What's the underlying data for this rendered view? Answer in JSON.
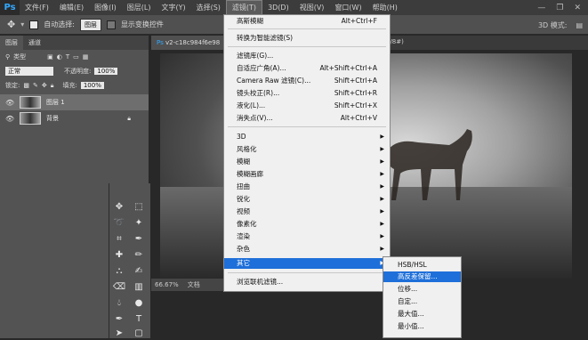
{
  "menubar": {
    "logo": "Ps",
    "items": [
      "文件(F)",
      "编辑(E)",
      "图像(I)",
      "图层(L)",
      "文字(Y)",
      "选择(S)",
      "滤镜(T)",
      "3D(D)",
      "视图(V)",
      "窗口(W)",
      "帮助(H)"
    ],
    "active_index": 6,
    "controls": [
      "—",
      "❐",
      "✕"
    ]
  },
  "options": {
    "auto_select_label": "自动选择:",
    "auto_select_value": "图层",
    "show_transform_label": "显示变换控件",
    "mode_3d": "3D 模式:"
  },
  "layers_panel": {
    "tabs": [
      "图层",
      "通道"
    ],
    "kind_label": "类型",
    "blend_mode": "正常",
    "opacity_label": "不透明度:",
    "opacity_value": "100%",
    "lock_label": "锁定:",
    "fill_label": "填充:",
    "fill_value": "100%",
    "layers": [
      {
        "name": "图层 1",
        "selected": true
      },
      {
        "name": "背景",
        "selected": false
      }
    ]
  },
  "document": {
    "tab_title": "v2-c18c984f6e98",
    "tab_suffix": "8/8#)",
    "zoom": "66.67%",
    "doc_label": "文档"
  },
  "filter_menu": {
    "items": [
      {
        "label": "高斯模糊",
        "shortcut": "Alt+Ctrl+F"
      },
      {
        "label": "转换为智能滤镜(S)",
        "shortcut": ""
      },
      {
        "label": "滤镜库(G)...",
        "shortcut": ""
      },
      {
        "label": "自适应广角(A)...",
        "shortcut": "Alt+Shift+Ctrl+A"
      },
      {
        "label": "Camera Raw 滤镜(C)...",
        "shortcut": "Shift+Ctrl+A"
      },
      {
        "label": "镜头校正(R)...",
        "shortcut": "Shift+Ctrl+R"
      },
      {
        "label": "液化(L)...",
        "shortcut": "Shift+Ctrl+X"
      },
      {
        "label": "消失点(V)...",
        "shortcut": "Alt+Ctrl+V"
      },
      {
        "label": "3D",
        "submenu": true
      },
      {
        "label": "风格化",
        "submenu": true
      },
      {
        "label": "模糊",
        "submenu": true
      },
      {
        "label": "模糊画廊",
        "submenu": true
      },
      {
        "label": "扭曲",
        "submenu": true
      },
      {
        "label": "锐化",
        "submenu": true
      },
      {
        "label": "视频",
        "submenu": true
      },
      {
        "label": "像素化",
        "submenu": true
      },
      {
        "label": "渲染",
        "submenu": true
      },
      {
        "label": "杂色",
        "submenu": true
      },
      {
        "label": "其它",
        "submenu": true,
        "highlighted": true
      },
      {
        "label": "浏览联机滤镜...",
        "shortcut": ""
      }
    ]
  },
  "other_submenu": {
    "items": [
      "HSB/HSL",
      "高反差保留...",
      "位移...",
      "自定...",
      "最大值...",
      "最小值..."
    ],
    "highlighted_index": 1
  }
}
